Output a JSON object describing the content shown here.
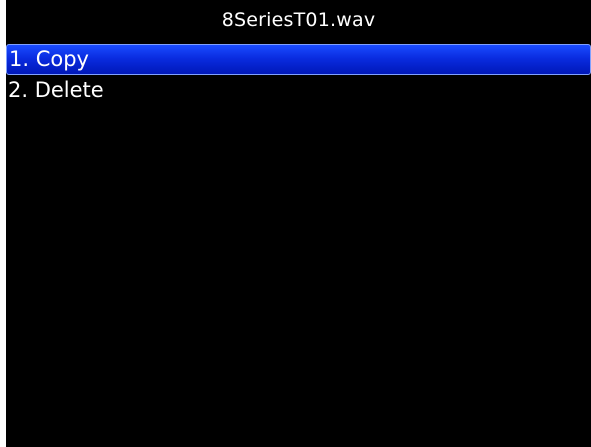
{
  "header": {
    "title": "8SeriesT01.wav"
  },
  "menu": {
    "selected_index": 0,
    "items": [
      {
        "label": "1. Copy"
      },
      {
        "label": "2. Delete"
      }
    ]
  },
  "colors": {
    "background": "#000000",
    "text": "#ffffff",
    "selection": "#0a2ce0"
  }
}
